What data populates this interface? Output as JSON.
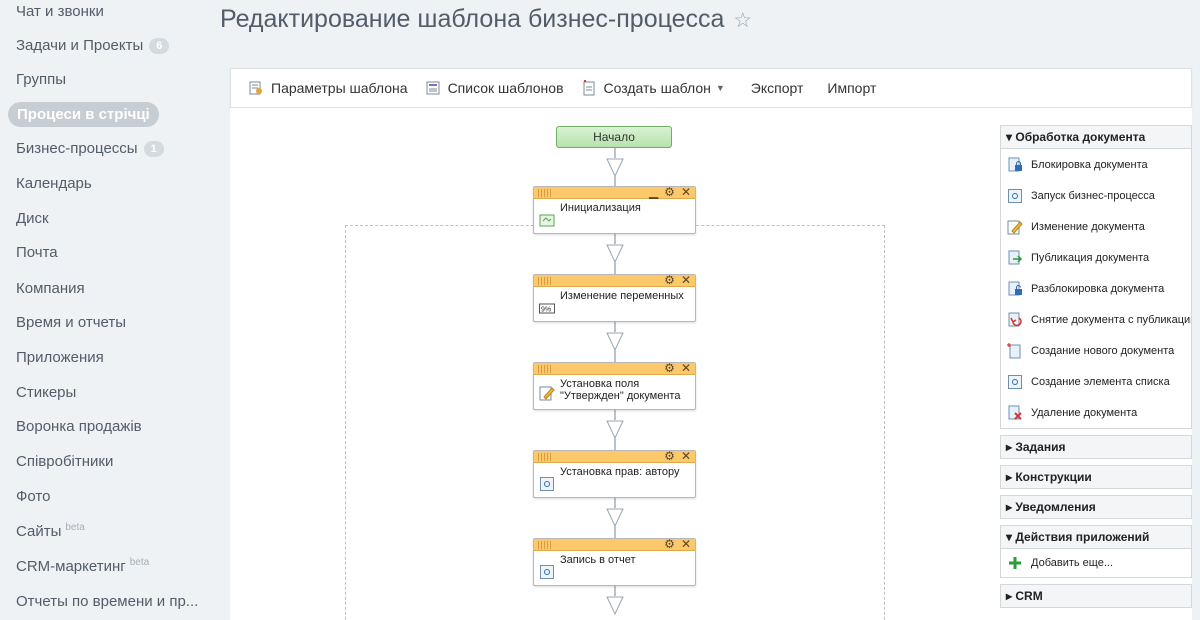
{
  "sidebar": {
    "items": [
      {
        "label": "Чат и звонки"
      },
      {
        "label": "Задачи и Проекты",
        "counter": "6"
      },
      {
        "label": "Группы"
      },
      {
        "label": "Процеси в стрічці",
        "active": true
      },
      {
        "label": "Бизнес-процессы",
        "counter": "1"
      },
      {
        "label": "Календарь"
      },
      {
        "label": "Диск"
      },
      {
        "label": "Почта"
      },
      {
        "label": "Компания"
      },
      {
        "label": "Время и отчеты"
      },
      {
        "label": "Приложения"
      },
      {
        "label": "Стикеры"
      },
      {
        "label": "Воронка продажів"
      },
      {
        "label": "Співробітники"
      },
      {
        "label": "Фото"
      },
      {
        "label": "Сайты",
        "badge": "beta"
      },
      {
        "label": "CRM-маркетинг",
        "badge": "beta"
      },
      {
        "label": "Отчеты по времени и пр..."
      }
    ]
  },
  "header": {
    "title": "Редактирование шаблона бизнес-процесса",
    "star": "☆"
  },
  "toolbar": {
    "params": "Параметры шаблона",
    "list": "Список шаблонов",
    "create": "Создать шаблон",
    "export": "Экспорт",
    "import": "Импорт"
  },
  "workflow": {
    "start": "Начало",
    "activities": [
      {
        "label": "Инициализация",
        "icon": "init-icon",
        "minimize": true
      },
      {
        "label": "Изменение переменных",
        "icon": "variables-icon"
      },
      {
        "label": "Установка поля \"Утвержден\" документа",
        "icon": "edit-doc-icon"
      },
      {
        "label": "Установка прав: автору",
        "icon": "generic-activity-icon"
      },
      {
        "label": "Запись в отчет",
        "icon": "generic-activity-icon"
      }
    ]
  },
  "panel": {
    "doc_section": "Обработка документа",
    "doc_items": [
      {
        "label": "Блокировка документа",
        "icon": "lock-doc-icon"
      },
      {
        "label": "Запуск бизнес-процесса",
        "icon": "start-bp-icon"
      },
      {
        "label": "Изменение документа",
        "icon": "edit-doc-icon"
      },
      {
        "label": "Публикация документа",
        "icon": "publish-doc-icon"
      },
      {
        "label": "Разблокировка документа",
        "icon": "unlock-doc-icon"
      },
      {
        "label": "Снятие документа с публикации",
        "icon": "unpublish-doc-icon"
      },
      {
        "label": "Создание нового документа",
        "icon": "new-doc-icon"
      },
      {
        "label": "Создание элемента списка",
        "icon": "list-item-icon"
      },
      {
        "label": "Удаление документа",
        "icon": "delete-doc-icon"
      }
    ],
    "tasks": "Задания",
    "constructions": "Конструкции",
    "notifications": "Уведомления",
    "app_actions": "Действия приложений",
    "add_more": "Добавить еще...",
    "crm": "CRM"
  }
}
